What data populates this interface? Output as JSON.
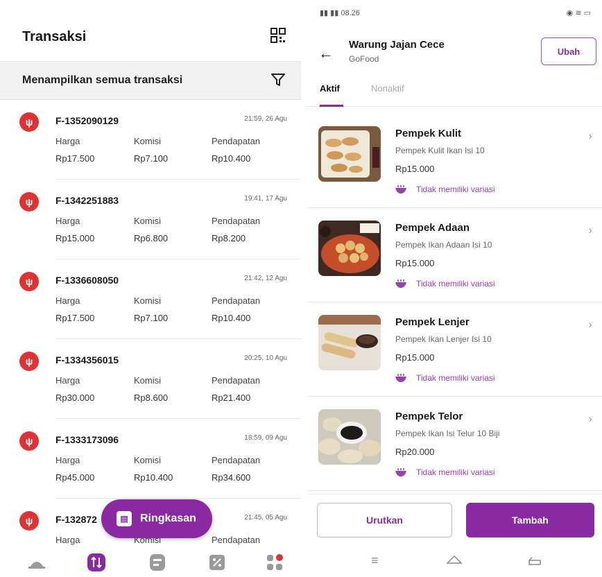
{
  "left": {
    "title": "Transaksi",
    "filter_text": "Menampilkan semua transaksi",
    "transactions": [
      {
        "id": "F-1352090129",
        "time": "21:59, 26 Agu",
        "harga_label": "Harga",
        "komisi_label": "Komisi",
        "pendapatan_label": "Pendapatan",
        "harga": "Rp17.500",
        "komisi": "Rp7.100",
        "pendapatan": "Rp10.400"
      },
      {
        "id": "F-1342251883",
        "time": "19:41, 17 Agu",
        "harga_label": "Harga",
        "komisi_label": "Komisi",
        "pendapatan_label": "Pendapatan",
        "harga": "Rp15.000",
        "komisi": "Rp6.800",
        "pendapatan": "Rp8.200"
      },
      {
        "id": "F-1336608050",
        "time": "21:42, 12 Agu",
        "harga_label": "Harga",
        "komisi_label": "Komisi",
        "pendapatan_label": "Pendapatan",
        "harga": "Rp17.500",
        "komisi": "Rp7.100",
        "pendapatan": "Rp10.400"
      },
      {
        "id": "F-1334356015",
        "time": "20:25, 10 Agu",
        "harga_label": "Harga",
        "komisi_label": "Komisi",
        "pendapatan_label": "Pendapatan",
        "harga": "Rp30.000",
        "komisi": "Rp8.600",
        "pendapatan": "Rp21.400"
      },
      {
        "id": "F-1333173096",
        "time": "18:59, 09 Agu",
        "harga_label": "Harga",
        "komisi_label": "Komisi",
        "pendapatan_label": "Pendapatan",
        "harga": "Rp45.000",
        "komisi": "Rp10.400",
        "pendapatan": "Rp34.600"
      },
      {
        "id": "F-132872",
        "time": "21:45, 05 Agu",
        "harga_label": "Harga",
        "komisi_label": "Komisi",
        "pendapatan_label": "Pendapatan",
        "harga": "",
        "komisi": "",
        "pendapatan": ""
      }
    ],
    "fab_label": "Ringkasan",
    "nav_icons": [
      "home-icon",
      "transactions-icon",
      "orders-icon",
      "promo-icon",
      "menu-grid-icon"
    ],
    "accent": "#8a2aa3",
    "tx_icon_color": "#e03232"
  },
  "right": {
    "status_left": "08.26",
    "status_right": "",
    "store_name": "Warung Jajan Cece",
    "store_sub": "GoFood",
    "ubah_label": "Ubah",
    "tab_active": "Aktif",
    "tab_inactive": "Nonaktif",
    "products": [
      {
        "name": "Pempek Kulit",
        "desc": "Pempek Kulit Ikan Isi 10",
        "price": "Rp15.000",
        "variant": "Tidak memiliki variasi"
      },
      {
        "name": "Pempek Adaan",
        "desc": "Pempek Ikan Adaan Isi 10",
        "price": "Rp15.000",
        "variant": "Tidak memiliki variasi"
      },
      {
        "name": "Pempek Lenjer",
        "desc": "Pempek Ikan Lenjer Isi 10",
        "price": "Rp15.000",
        "variant": "Tidak memiliki variasi"
      },
      {
        "name": "Pempek Telor",
        "desc": "Pempek Ikan Isi Telur 10 Biji",
        "price": "Rp20.000",
        "variant": "Tidak memiliki variasi"
      }
    ],
    "urutkan_label": "Urutkan",
    "tambah_label": "Tambah"
  }
}
